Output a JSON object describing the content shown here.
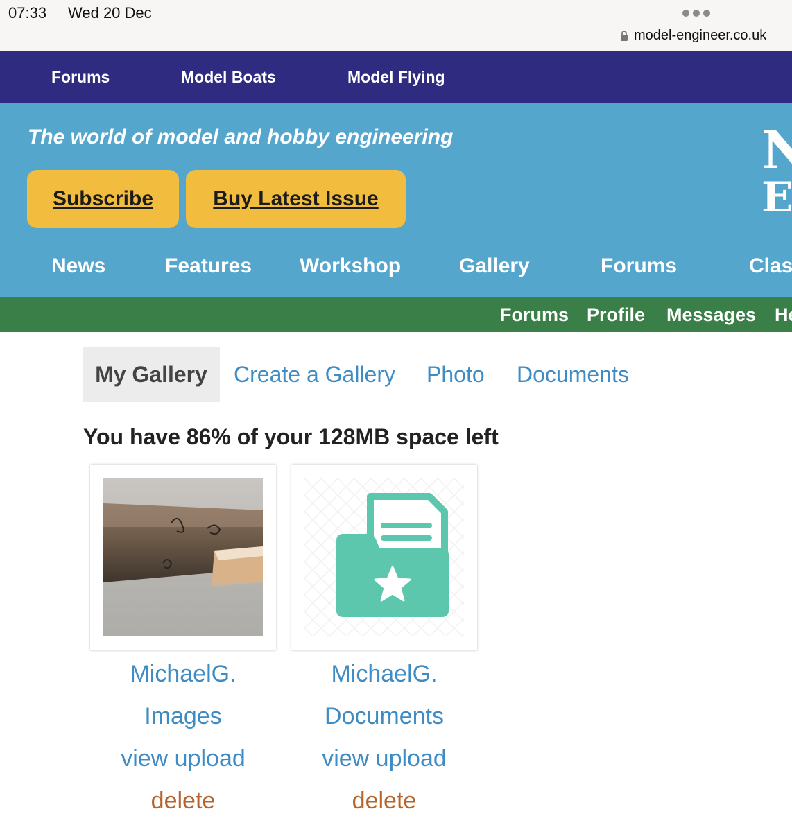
{
  "status_bar": {
    "time": "07:33",
    "date": "Wed 20 Dec",
    "url": "model-engineer.co.uk"
  },
  "top_nav": [
    "Forums",
    "Model Boats",
    "Model Flying"
  ],
  "header": {
    "tagline": "The world of model and hobby engineering",
    "subscribe_label": "Subscribe",
    "buy_issue_label": "Buy Latest Issue",
    "logo_line1": "N",
    "logo_line2": "E"
  },
  "main_nav": [
    "News",
    "Features",
    "Workshop",
    "Gallery",
    "Forums",
    "Clas"
  ],
  "user_nav": [
    "Forums",
    "Profile",
    "Messages",
    "He"
  ],
  "tabs": {
    "active": "My Gallery",
    "links": [
      "Create a Gallery",
      "Photo",
      "Documents"
    ]
  },
  "space_note": "You have 86% of your 128MB space left",
  "galleries": [
    {
      "title_line1": "MichaelG.",
      "title_line2": "Images",
      "view_label": "view upload",
      "delete_label": "delete",
      "thumbnail": "photo-thumbnail"
    },
    {
      "title_line1": "MichaelG.",
      "title_line2": "Documents",
      "view_label": "view upload",
      "delete_label": "delete",
      "thumbnail": "folder-document-icon"
    }
  ],
  "colors": {
    "top_nav_bg": "#2f2b80",
    "header_bg": "#55a6cd",
    "button_yellow": "#f2bc3f",
    "green_bar": "#3a7f47",
    "link_blue": "#3f8cc4",
    "delete_brown": "#b6642b",
    "folder_teal": "#5cc7ad"
  }
}
